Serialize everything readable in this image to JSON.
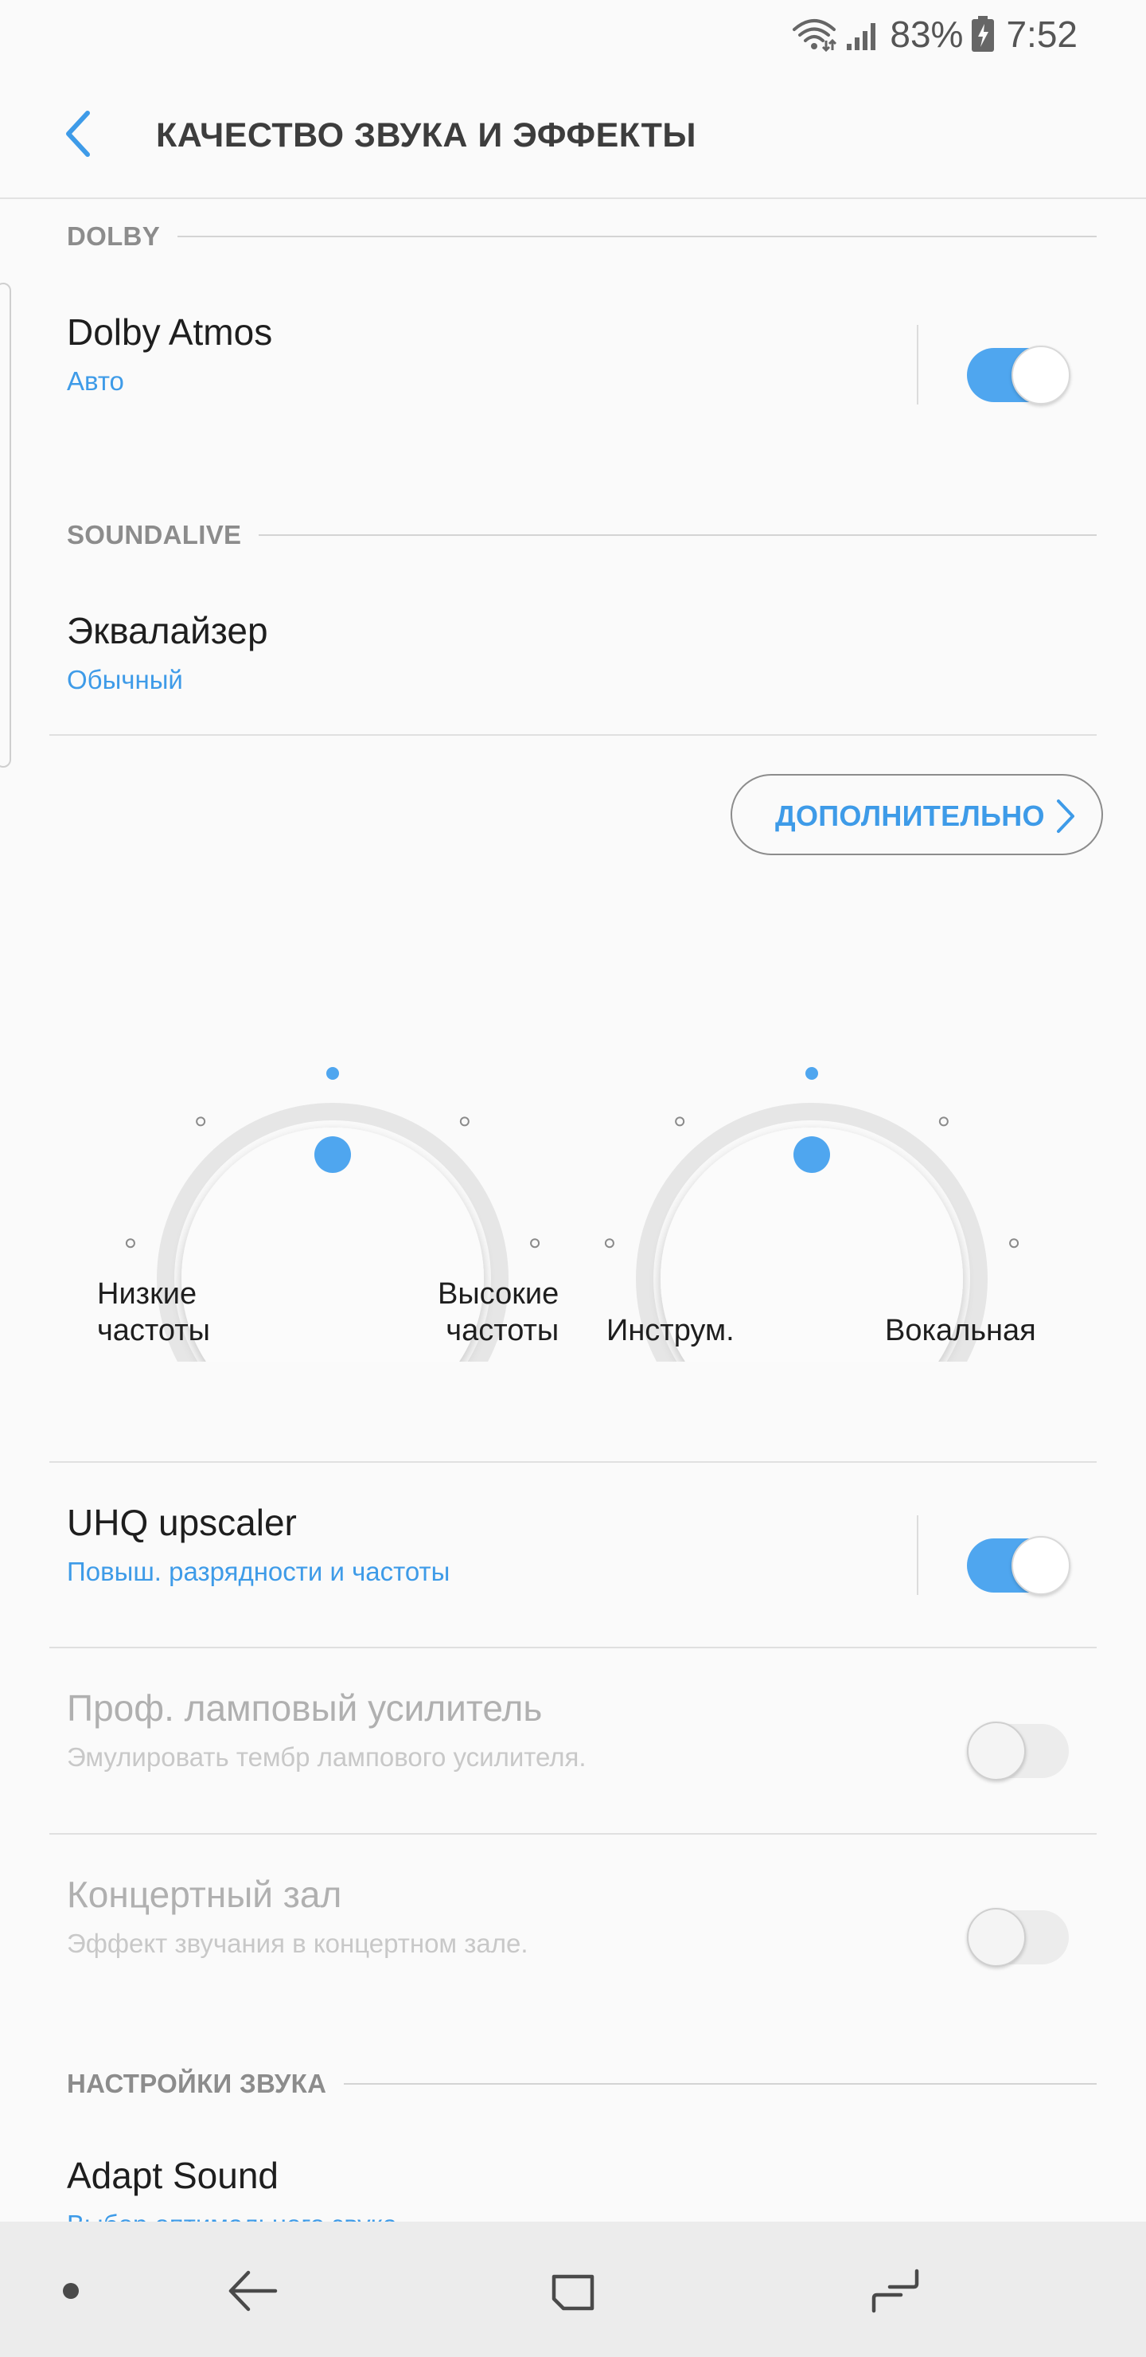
{
  "status_bar": {
    "battery_percent": "83%",
    "time": "7:52",
    "icons": [
      "wifi-icon",
      "signal-icon",
      "battery-icon"
    ]
  },
  "header": {
    "title": "КАЧЕСТВО ЗВУКА И ЭФФЕКТЫ",
    "back_icon": "back-chevron-icon"
  },
  "sections": {
    "dolby": "DOLBY",
    "soundalive": "SOUNDALIVE",
    "sound_settings": "НАСТРОЙКИ ЗВУКА"
  },
  "dolby_atmos": {
    "title": "Dolby Atmos",
    "subtitle": "Авто",
    "enabled": true
  },
  "equalizer": {
    "title": "Эквалайзер",
    "subtitle": "Обычный",
    "advanced_label": "ДОПОЛНИТЕЛЬНО"
  },
  "dials": [
    {
      "left_label": "Низкие\nчастоты",
      "right_label": "Высокие\nчастоты",
      "level": 0
    },
    {
      "left_label": "Инструм.",
      "right_label": "Вокальная",
      "level": 0
    }
  ],
  "uhq": {
    "title": "UHQ upscaler",
    "subtitle": "Повыш. разрядности и частоты",
    "enabled": true
  },
  "tube_amp": {
    "title": "Проф. ламповый усилитель",
    "subtitle": "Эмулировать тембр лампового усилителя.",
    "enabled": false
  },
  "concert_hall": {
    "title": "Концертный зал",
    "subtitle": "Эффект звучания в концертном зале.",
    "enabled": false
  },
  "adapt_sound": {
    "title": "Adapt Sound",
    "subtitle": "Выбор оптимального звука"
  },
  "nav": {
    "icons": [
      "dot-icon",
      "back-arrow-icon",
      "home-square-icon",
      "recents-icon"
    ]
  },
  "colors": {
    "accent": "#4fa6ef",
    "accent_text": "#3e9be8",
    "background": "#fafafa"
  }
}
